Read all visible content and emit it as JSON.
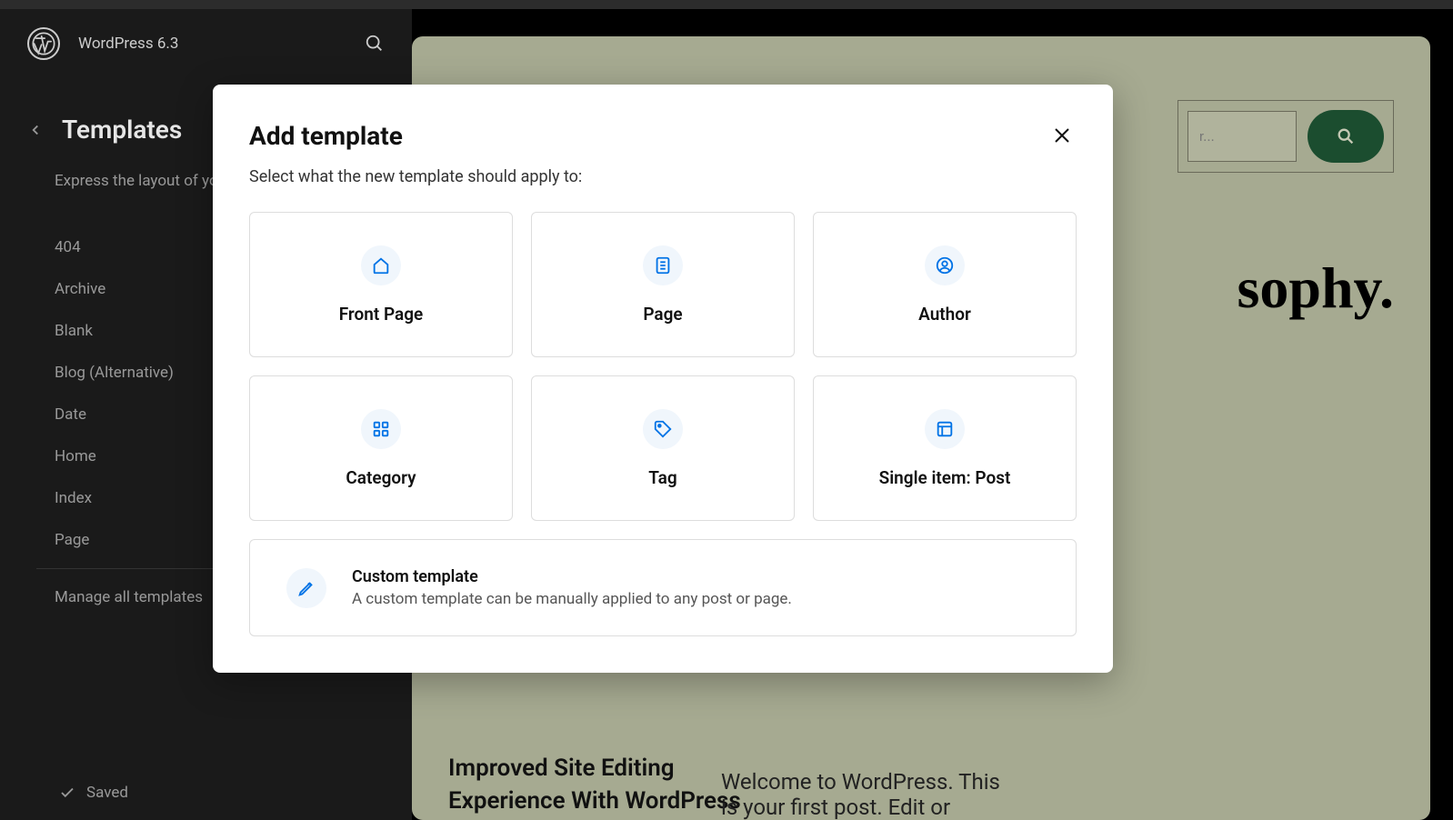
{
  "header": {
    "site_title": "WordPress 6.3"
  },
  "sidebar": {
    "back_label": "Back",
    "title": "Templates",
    "description": "Express the layout of yo",
    "items": [
      {
        "label": "404"
      },
      {
        "label": "Archive"
      },
      {
        "label": "Blank"
      },
      {
        "label": "Blog (Alternative)"
      },
      {
        "label": "Date"
      },
      {
        "label": "Home"
      },
      {
        "label": "Index"
      },
      {
        "label": "Page"
      }
    ],
    "manage_all": "Manage all templates",
    "saved_label": "Saved"
  },
  "preview": {
    "search_placeholder": "r...",
    "heading": "sophy.",
    "post_title_1": "Improved Site Editing",
    "post_title_2": "Experience With WordPress",
    "excerpt_1": "Welcome to WordPress. This",
    "excerpt_2": "is your first post. Edit or"
  },
  "modal": {
    "title": "Add template",
    "subtitle": "Select what the new template should apply to:",
    "options": [
      {
        "label": "Front Page",
        "icon": "home"
      },
      {
        "label": "Page",
        "icon": "page"
      },
      {
        "label": "Author",
        "icon": "author"
      },
      {
        "label": "Category",
        "icon": "category"
      },
      {
        "label": "Tag",
        "icon": "tag"
      },
      {
        "label": "Single item: Post",
        "icon": "post"
      }
    ],
    "custom": {
      "title": "Custom template",
      "description": "A custom template can be manually applied to any post or page."
    }
  },
  "colors": {
    "accent": "#0073e6",
    "canvas": "#a6aa91",
    "search_btn": "#1b4d2f"
  }
}
